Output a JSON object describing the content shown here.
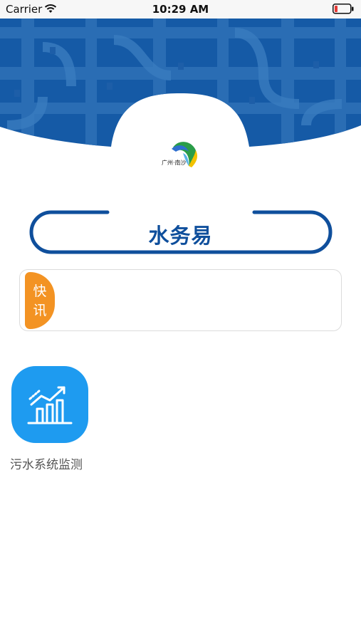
{
  "status_bar": {
    "carrier": "Carrier",
    "time": "10:29 AM"
  },
  "header": {
    "logo_text": "广州·南沙",
    "colors": {
      "banner": "#155aa6",
      "pipe": "#2b6fb7"
    }
  },
  "title": {
    "text": "水务易",
    "color": "#0f4f9c"
  },
  "news": {
    "tag_label": "快讯",
    "tag_color": "#f39323"
  },
  "apps": [
    {
      "label": "污水系统监测",
      "icon": "chart-growth-icon",
      "color": "#1e9bf0"
    }
  ]
}
